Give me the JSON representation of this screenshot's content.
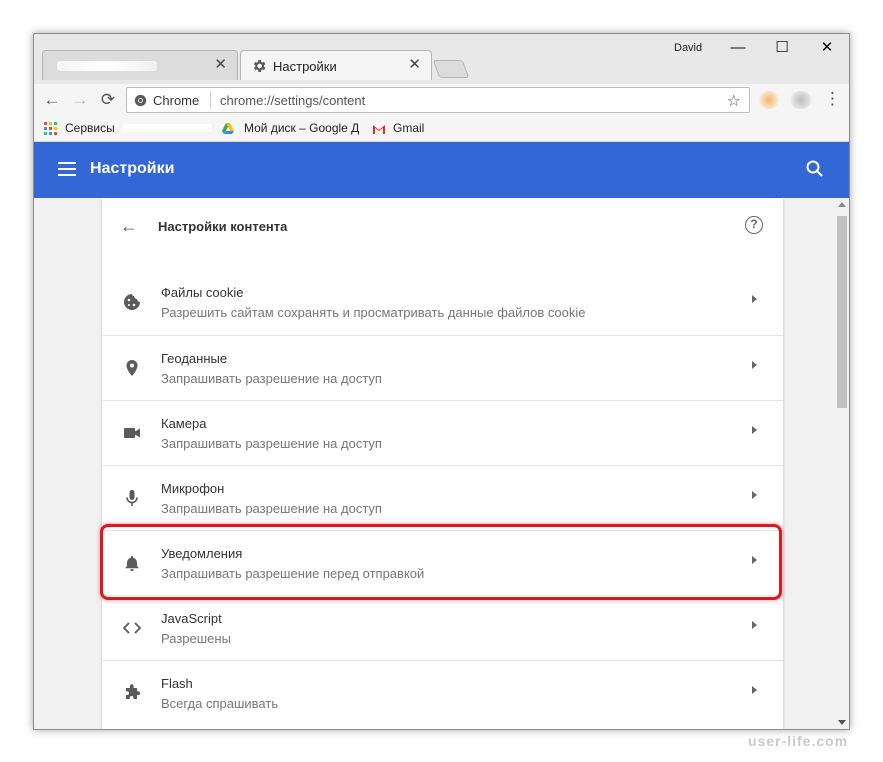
{
  "window": {
    "user": "David",
    "minimize": "—",
    "maximize": "☐",
    "close": "✕"
  },
  "tabs": [
    {
      "title": "",
      "close": "✕"
    },
    {
      "title": "Настройки",
      "close": "✕"
    }
  ],
  "toolbar": {
    "back": "←",
    "forward": "→",
    "reload": "⟳",
    "site_name": "Chrome",
    "url": "chrome://settings/content",
    "star": "☆",
    "menu": "⋮"
  },
  "bookmarks": [
    {
      "label": "Сервисы",
      "icon": "apps-icon"
    },
    {
      "label": "Мой диск – Google Д",
      "icon": "google-drive-icon"
    },
    {
      "label": "Gmail",
      "icon": "gmail-icon"
    }
  ],
  "header": {
    "title": "Настройки"
  },
  "card": {
    "title": "Настройки контента",
    "help": "?",
    "rows": [
      {
        "title": "Файлы cookie",
        "sub": "Разрешить сайтам сохранять и просматривать данные файлов cookie",
        "icon": "cookie-icon"
      },
      {
        "title": "Геоданные",
        "sub": "Запрашивать разрешение на доступ",
        "icon": "location-pin-icon"
      },
      {
        "title": "Камера",
        "sub": "Запрашивать разрешение на доступ",
        "icon": "camera-icon"
      },
      {
        "title": "Микрофон",
        "sub": "Запрашивать разрешение на доступ",
        "icon": "microphone-icon"
      },
      {
        "title": "Уведомления",
        "sub": "Запрашивать разрешение перед отправкой",
        "icon": "bell-icon"
      },
      {
        "title": "JavaScript",
        "sub": "Разрешены",
        "icon": "code-icon"
      },
      {
        "title": "Flash",
        "sub": "Всегда спрашивать",
        "icon": "puzzle-piece-icon"
      }
    ]
  },
  "colors": {
    "header": "#3367d6",
    "highlight": "#e0161e"
  },
  "watermark": "user-life.com"
}
